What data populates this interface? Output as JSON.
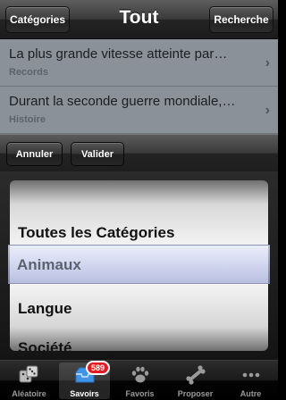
{
  "navbar": {
    "left_button": "Catégories",
    "title": "Tout",
    "right_button": "Recherche"
  },
  "list": {
    "rows": [
      {
        "title": "La plus grande vitesse atteinte par…",
        "category": "Records"
      },
      {
        "title": "Durant la seconde guerre mondiale,…",
        "category": "Histoire"
      }
    ]
  },
  "toolbar": {
    "cancel_label": "Annuler",
    "confirm_label": "Valider"
  },
  "picker": {
    "items": [
      "Toutes les Catégories",
      "Animaux",
      "Langue",
      "Société"
    ],
    "selected": "Animaux"
  },
  "tabbar": {
    "tabs": [
      {
        "label": "Aléatoire",
        "icon": "dice-icon"
      },
      {
        "label": "Savoirs",
        "icon": "inbox-icon",
        "badge": "589",
        "active": true
      },
      {
        "label": "Favoris",
        "icon": "paw-icon"
      },
      {
        "label": "Proposer",
        "icon": "bone-icon"
      },
      {
        "label": "Autre",
        "icon": "more-icon"
      }
    ]
  },
  "colors": {
    "badge": "#e01c22",
    "selection": "#b4bde6",
    "dim_overlay": "#8b9198"
  }
}
